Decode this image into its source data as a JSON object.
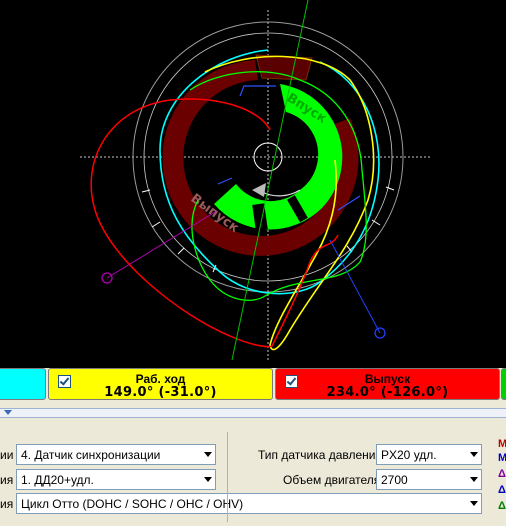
{
  "phases": {
    "power_stroke": {
      "title": "Раб. ход",
      "value": "149.0° (-31.0°)",
      "color": "#ffff00",
      "checked": true
    },
    "exhaust": {
      "title": "Выпуск",
      "value": "234.0° (-126.0°)",
      "color": "#ff0000",
      "checked": true
    },
    "intake_left_color": "#00ffff",
    "right_edge_color": "#00d000"
  },
  "diagram": {
    "intake_label": "Впуск",
    "exhaust_label": "Выпуск",
    "colors": {
      "intake": "#00ff00",
      "exhaust": "#6b0000",
      "cyan_trace": "#00ffff",
      "yellow_trace": "#ffff00",
      "red_trace": "#ff0000",
      "green_trace": "#00ff00",
      "marker_magenta": "#b000b0",
      "marker_blue": "#0000ff"
    }
  },
  "settings": {
    "sync_label": "ии",
    "sync_value": "4.  Датчик синхронизации",
    "channel_label": "ия",
    "channel_value": "1.  ДД20+удл.",
    "cycle_label": "ия",
    "cycle_value": "Цикл Отто (DOHC / SOHC / OHC / OHV)",
    "pressure_sensor_label": "Тип датчика давления",
    "pressure_sensor_value": "PX20 удл.",
    "engine_volume_label": "Объем двигателя",
    "engine_volume_value": "2700"
  },
  "legend": [
    "М",
    "М",
    "Δ",
    "Δ",
    "Δ"
  ]
}
